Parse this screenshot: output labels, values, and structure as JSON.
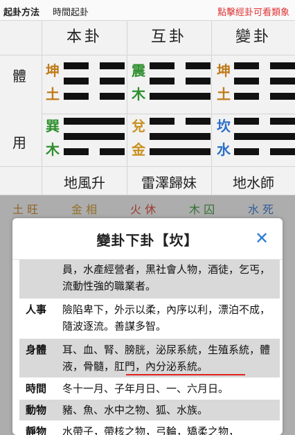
{
  "topbar": {
    "method_label": "起卦方法",
    "method_value": "時間起卦",
    "hint": "點擊經卦可看類象"
  },
  "grid": {
    "headers": [
      "本卦",
      "互卦",
      "變卦"
    ],
    "row_labels": {
      "ti": "體",
      "yong": "用"
    },
    "hexagrams": [
      {
        "upper": {
          "trigram": "坤",
          "element": "土",
          "color": "#c07a18"
        },
        "lower": {
          "trigram": "巽",
          "element": "木",
          "color": "#2e8f2e"
        },
        "name": "地風升"
      },
      {
        "upper": {
          "trigram": "震",
          "element": "木",
          "color": "#2e8f2e"
        },
        "lower": {
          "trigram": "兌",
          "element": "金",
          "color": "#c89020"
        },
        "name": "雷澤歸妹"
      },
      {
        "upper": {
          "trigram": "坤",
          "element": "土",
          "color": "#c07a18"
        },
        "lower": {
          "trigram": "坎",
          "element": "水",
          "color": "#2a6fc9"
        },
        "name": "地水師"
      }
    ]
  },
  "wuxing": [
    {
      "element": "土",
      "state": "旺",
      "color": "#c07a18"
    },
    {
      "element": "金",
      "state": "相",
      "color": "#c89020"
    },
    {
      "element": "火",
      "state": "休",
      "color": "#d63a2a"
    },
    {
      "element": "木",
      "state": "囚",
      "color": "#2e8f2e"
    },
    {
      "element": "水",
      "state": "死",
      "color": "#2a6fc9"
    }
  ],
  "modal": {
    "title": "變卦下卦【坎】",
    "close_icon": "close-icon",
    "rows": [
      {
        "label": "",
        "text": "員，水產經營者，黑社會人物，酒徒，乞丐，流動性強的職業者。"
      },
      {
        "label": "人事",
        "text": "險陷卑下，外示以柔，內序以利，漂泊不成，隨波逐流。善謀多智。"
      },
      {
        "label": "身體",
        "text": "耳、血、腎、膀胱，泌尿系統，生殖系統，體液，骨髓，肛門，內分泌系統。"
      },
      {
        "label": "時間",
        "text": "冬十一月、子年月日、一、六月日。"
      },
      {
        "label": "動物",
        "text": "豬、魚、水中之物、狐、水族。"
      },
      {
        "label": "靜物",
        "text": "水帶子，帶核之物，弓輪，矯柔之物，"
      }
    ]
  }
}
